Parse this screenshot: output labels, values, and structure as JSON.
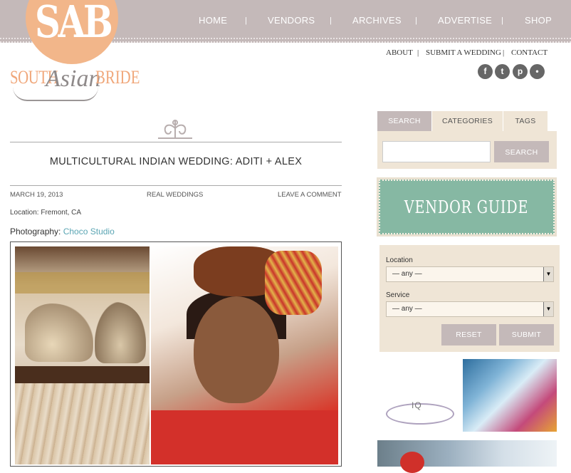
{
  "header": {
    "logo_mark": "SAB",
    "logo_words": [
      "SOUTH",
      "Asian",
      "BRIDE"
    ],
    "nav": [
      "HOME",
      "VENDORS",
      "ARCHIVES",
      "ADVERTISE",
      "SHOP"
    ],
    "separator": "|",
    "utility_nav": [
      "ABOUT",
      "SUBMIT A WEDDING",
      "CONTACT"
    ],
    "social_icons": [
      "facebook-icon",
      "twitter-icon",
      "pinterest-icon",
      "rss-icon"
    ],
    "social_glyphs": [
      "f",
      "t",
      "p",
      "•"
    ]
  },
  "post": {
    "title": "MULTICULTURAL INDIAN WEDDING: ADITI + ALEX",
    "date": "MARCH 19, 2013",
    "category": "REAL WEDDINGS",
    "comment_link": "LEAVE A COMMENT",
    "location": "Location: Fremont, CA",
    "photography_label": "Photography: ",
    "photographer": "Choco Studio"
  },
  "sidebar": {
    "tabs": [
      "SEARCH",
      "CATEGORIES",
      "TAGS"
    ],
    "active_tab": "SEARCH",
    "search_value": "",
    "search_button": "SEARCH",
    "vendor_guide": "VENDOR GUIDE",
    "filter": {
      "location_label": "Location",
      "location_value": "— any —",
      "service_label": "Service",
      "service_value": "— any —",
      "reset_button": "RESET",
      "submit_button": "SUBMIT"
    },
    "ad_text": "IQ"
  },
  "colors": {
    "topbar": "#c4b9b9",
    "logo_peach": "#f2b68a",
    "link_teal": "#5aa5b3",
    "panel_beige": "#efe5d6",
    "vendor_green": "#86b8a3"
  }
}
